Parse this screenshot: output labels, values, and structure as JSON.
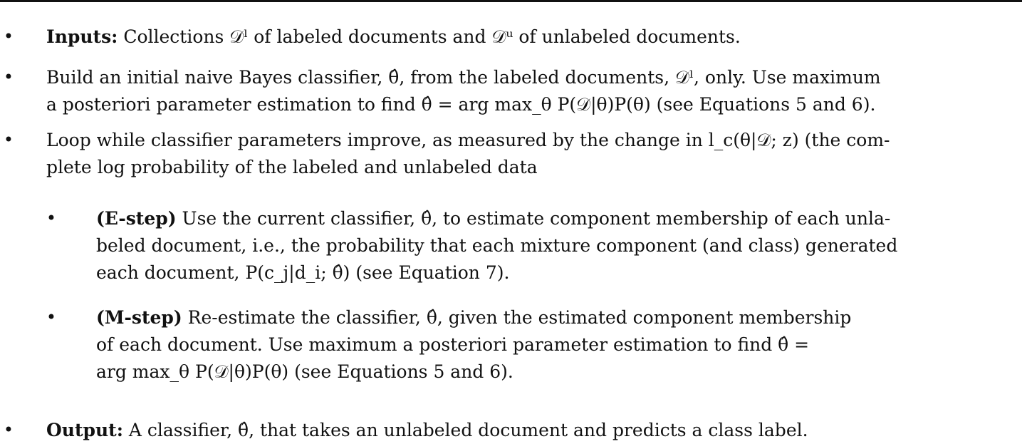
{
  "algorithm": {
    "items": [
      {
        "level": 0,
        "lead": "Inputs:",
        "lines": [
          "Collections 𝒟ˡ of labeled documents and 𝒟ᵘ of unlabeled documents."
        ]
      },
      {
        "level": 0,
        "lead": "",
        "lines": [
          "Build an initial naive Bayes classifier, θ̂, from the labeled documents, 𝒟ˡ, only. Use maximum",
          "a posteriori parameter estimation to find θ̂ = arg max_θ P(𝒟|θ)P(θ) (see Equations 5 and 6)."
        ]
      },
      {
        "level": 0,
        "lead": "",
        "lines": [
          "Loop while classifier parameters improve, as measured by the change in l_c(θ|𝒟; z) (the com-",
          "plete log probability of the labeled and unlabeled data"
        ]
      },
      {
        "level": 1,
        "lead": "(E-step)",
        "lines": [
          "Use the current classifier, θ̂, to estimate component membership of each unla-",
          "beled document, i.e., the probability that each mixture component (and class) generated",
          "each document, P(c_j|d_i; θ̂) (see Equation 7)."
        ]
      },
      {
        "level": 1,
        "lead": "(M-step)",
        "lines": [
          "Re-estimate the classifier, θ̂, given the estimated component membership",
          "of each document. Use maximum a posteriori parameter estimation to find θ̂ =",
          "arg max_θ P(𝒟|θ)P(θ) (see Equations 5 and 6)."
        ]
      },
      {
        "level": 0,
        "lead": "Output:",
        "lines": [
          "A classifier, θ̂, that takes an unlabeled document and predicts a class label."
        ]
      }
    ],
    "bullet_glyph": "•"
  }
}
